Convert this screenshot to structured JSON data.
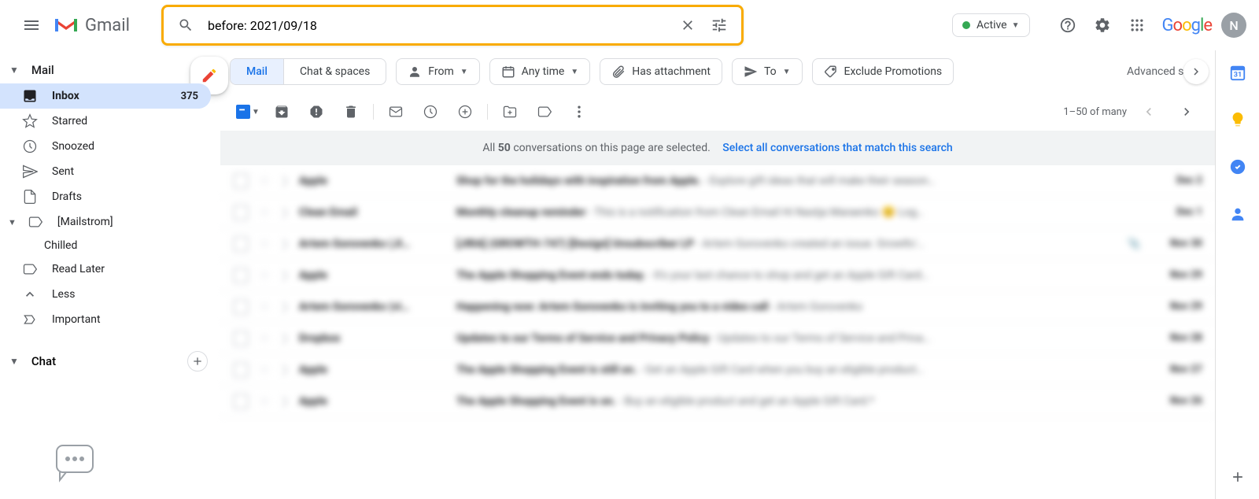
{
  "header": {
    "gmail_text": "Gmail",
    "search_value": "before: 2021/09/18",
    "status_text": "Active",
    "avatar_initial": "N",
    "google_text": "Google"
  },
  "sidebar": {
    "mail_label": "Mail",
    "chat_label": "Chat",
    "inbox_count": "375",
    "items": [
      {
        "label": "Inbox"
      },
      {
        "label": "Starred"
      },
      {
        "label": "Snoozed"
      },
      {
        "label": "Sent"
      },
      {
        "label": "Drafts"
      },
      {
        "label": "[Mailstrom]"
      },
      {
        "label": "Chilled"
      },
      {
        "label": "Read Later"
      },
      {
        "label": "Less"
      },
      {
        "label": "Important"
      }
    ]
  },
  "filters": {
    "mail": "Mail",
    "chat_spaces": "Chat & spaces",
    "from": "From",
    "any_time": "Any time",
    "has_attachment": "Has attachment",
    "to": "To",
    "exclude_promotions": "Exclude Promotions",
    "advanced": "Advanced search"
  },
  "toolbar": {
    "page_info": "1–50 of many"
  },
  "banner": {
    "prefix": "All ",
    "count": "50",
    "middle": " conversations on this page are selected.",
    "link": "Select all conversations that match this search"
  },
  "emails": [
    {
      "sender": "Apple",
      "subject": "Shop for the holidays with inspiration from Apple.",
      "snippet": " - Explore gift ideas that will make their season…",
      "date": "Dec 2",
      "attach": false
    },
    {
      "sender": "Clean Email",
      "subject": "Monthly cleanup reminder",
      "snippet": " - This is a notification from Clean Email Hi Nastja Maraenko 😊 Log…",
      "date": "Dec 1",
      "attach": false
    },
    {
      "sender": "Artem Gorovenko (JI…",
      "subject": "[JIRA] (GROWTH-747) [Design] Unsubscriber LP",
      "snippet": " - Artem Gorovenko created an issue. Growth/…",
      "date": "Nov 30",
      "attach": true
    },
    {
      "sender": "Apple",
      "subject": "The Apple Shopping Event ends today.",
      "snippet": " - It's your last chance to shop and get an Apple Gift Card…",
      "date": "Nov 29",
      "attach": false
    },
    {
      "sender": "Artem Gorovenko (vi…",
      "subject": "Happening now: Artem Gorovenko is inviting you to a video call",
      "snippet": " - Artem Gorovenko <artem@cl…",
      "date": "Nov 29",
      "attach": false
    },
    {
      "sender": "Dropbox",
      "subject": "Updates to our Terms of Service and Privacy Policy",
      "snippet": " - Updates to our Terms of Service and Priva…",
      "date": "Nov 28",
      "attach": false
    },
    {
      "sender": "Apple",
      "subject": "The Apple Shopping Event is still on.",
      "snippet": " - Get an Apple Gift Card when you buy an eligible product…",
      "date": "Nov 27",
      "attach": false
    },
    {
      "sender": "Apple",
      "subject": "The Apple Shopping Event is on.",
      "snippet": " - Buy an eligible product and get an Apple Gift Card.*",
      "date": "Nov 26",
      "attach": false
    }
  ]
}
